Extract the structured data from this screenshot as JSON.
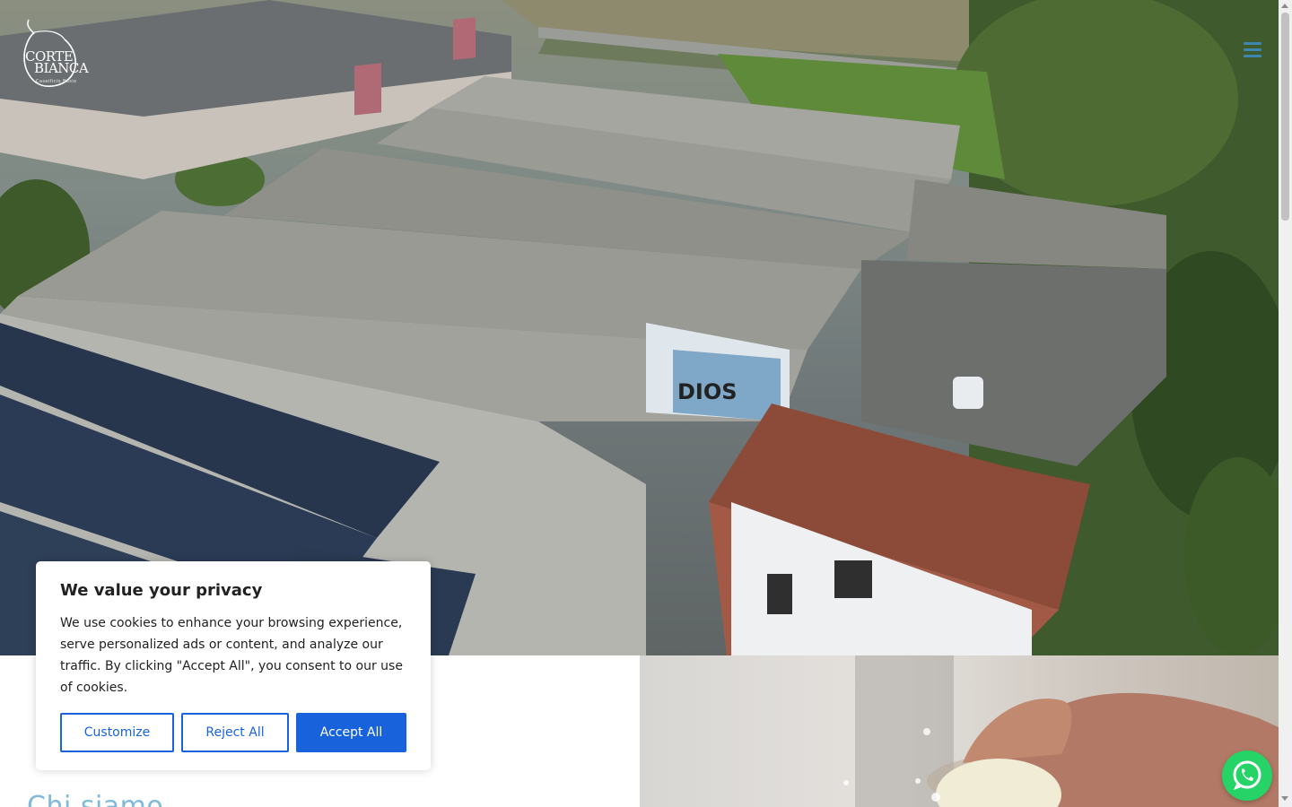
{
  "header": {
    "logo": {
      "name_line1": "CORTE",
      "name_line2": "BIANCA",
      "tagline": "Caseificio Bosio"
    },
    "menu_icon": "hamburger-menu-icon"
  },
  "hero": {
    "mural_text": "DIOS"
  },
  "about": {
    "title": "Chi siamo"
  },
  "cookie_banner": {
    "title": "We value your privacy",
    "body": "We use cookies to enhance your browsing experience, serve personalized ads or content, and analyze our traffic. By clicking \"Accept All\", you consent to our use of cookies.",
    "buttons": {
      "customize": "Customize",
      "reject": "Reject All",
      "accept": "Accept All"
    }
  },
  "floating": {
    "whatsapp_icon": "whatsapp-icon"
  },
  "colors": {
    "accent": "#1863dc",
    "menu": "#3e86b0",
    "title": "#7fbad8",
    "whatsapp": "#25d366"
  }
}
